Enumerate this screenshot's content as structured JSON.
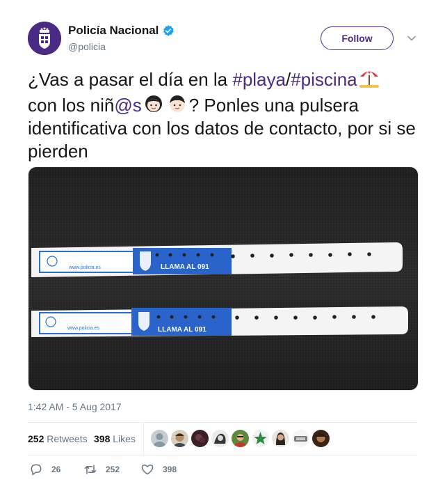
{
  "author": {
    "name": "Policía Nacional",
    "handle": "@policia",
    "follow_label": "Follow"
  },
  "tweet": {
    "part1": "¿Vas a pasar el día en la ",
    "hashtag1": "#playa",
    "slash": "/",
    "hashtag2": "#piscina",
    "part2": "con los niñ",
    "mention": "@s",
    "part3": "? Ponles una pulsera identificativa con los datos de contacto, por si se pierden"
  },
  "media": {
    "website": "www.policia.es",
    "call_text": "LLAMA AL 091"
  },
  "timestamp": "1:42 AM - 5 Aug 2017",
  "stats": {
    "retweets_count": "252",
    "retweets_label": "Retweets",
    "likes_count": "398",
    "likes_label": "Likes"
  },
  "actions": {
    "reply_count": "26",
    "retweet_count": "252",
    "like_count": "398"
  },
  "colors": {
    "brand": "#4a2a82",
    "verified": "#1da1f2",
    "secondary_text": "#657786"
  }
}
